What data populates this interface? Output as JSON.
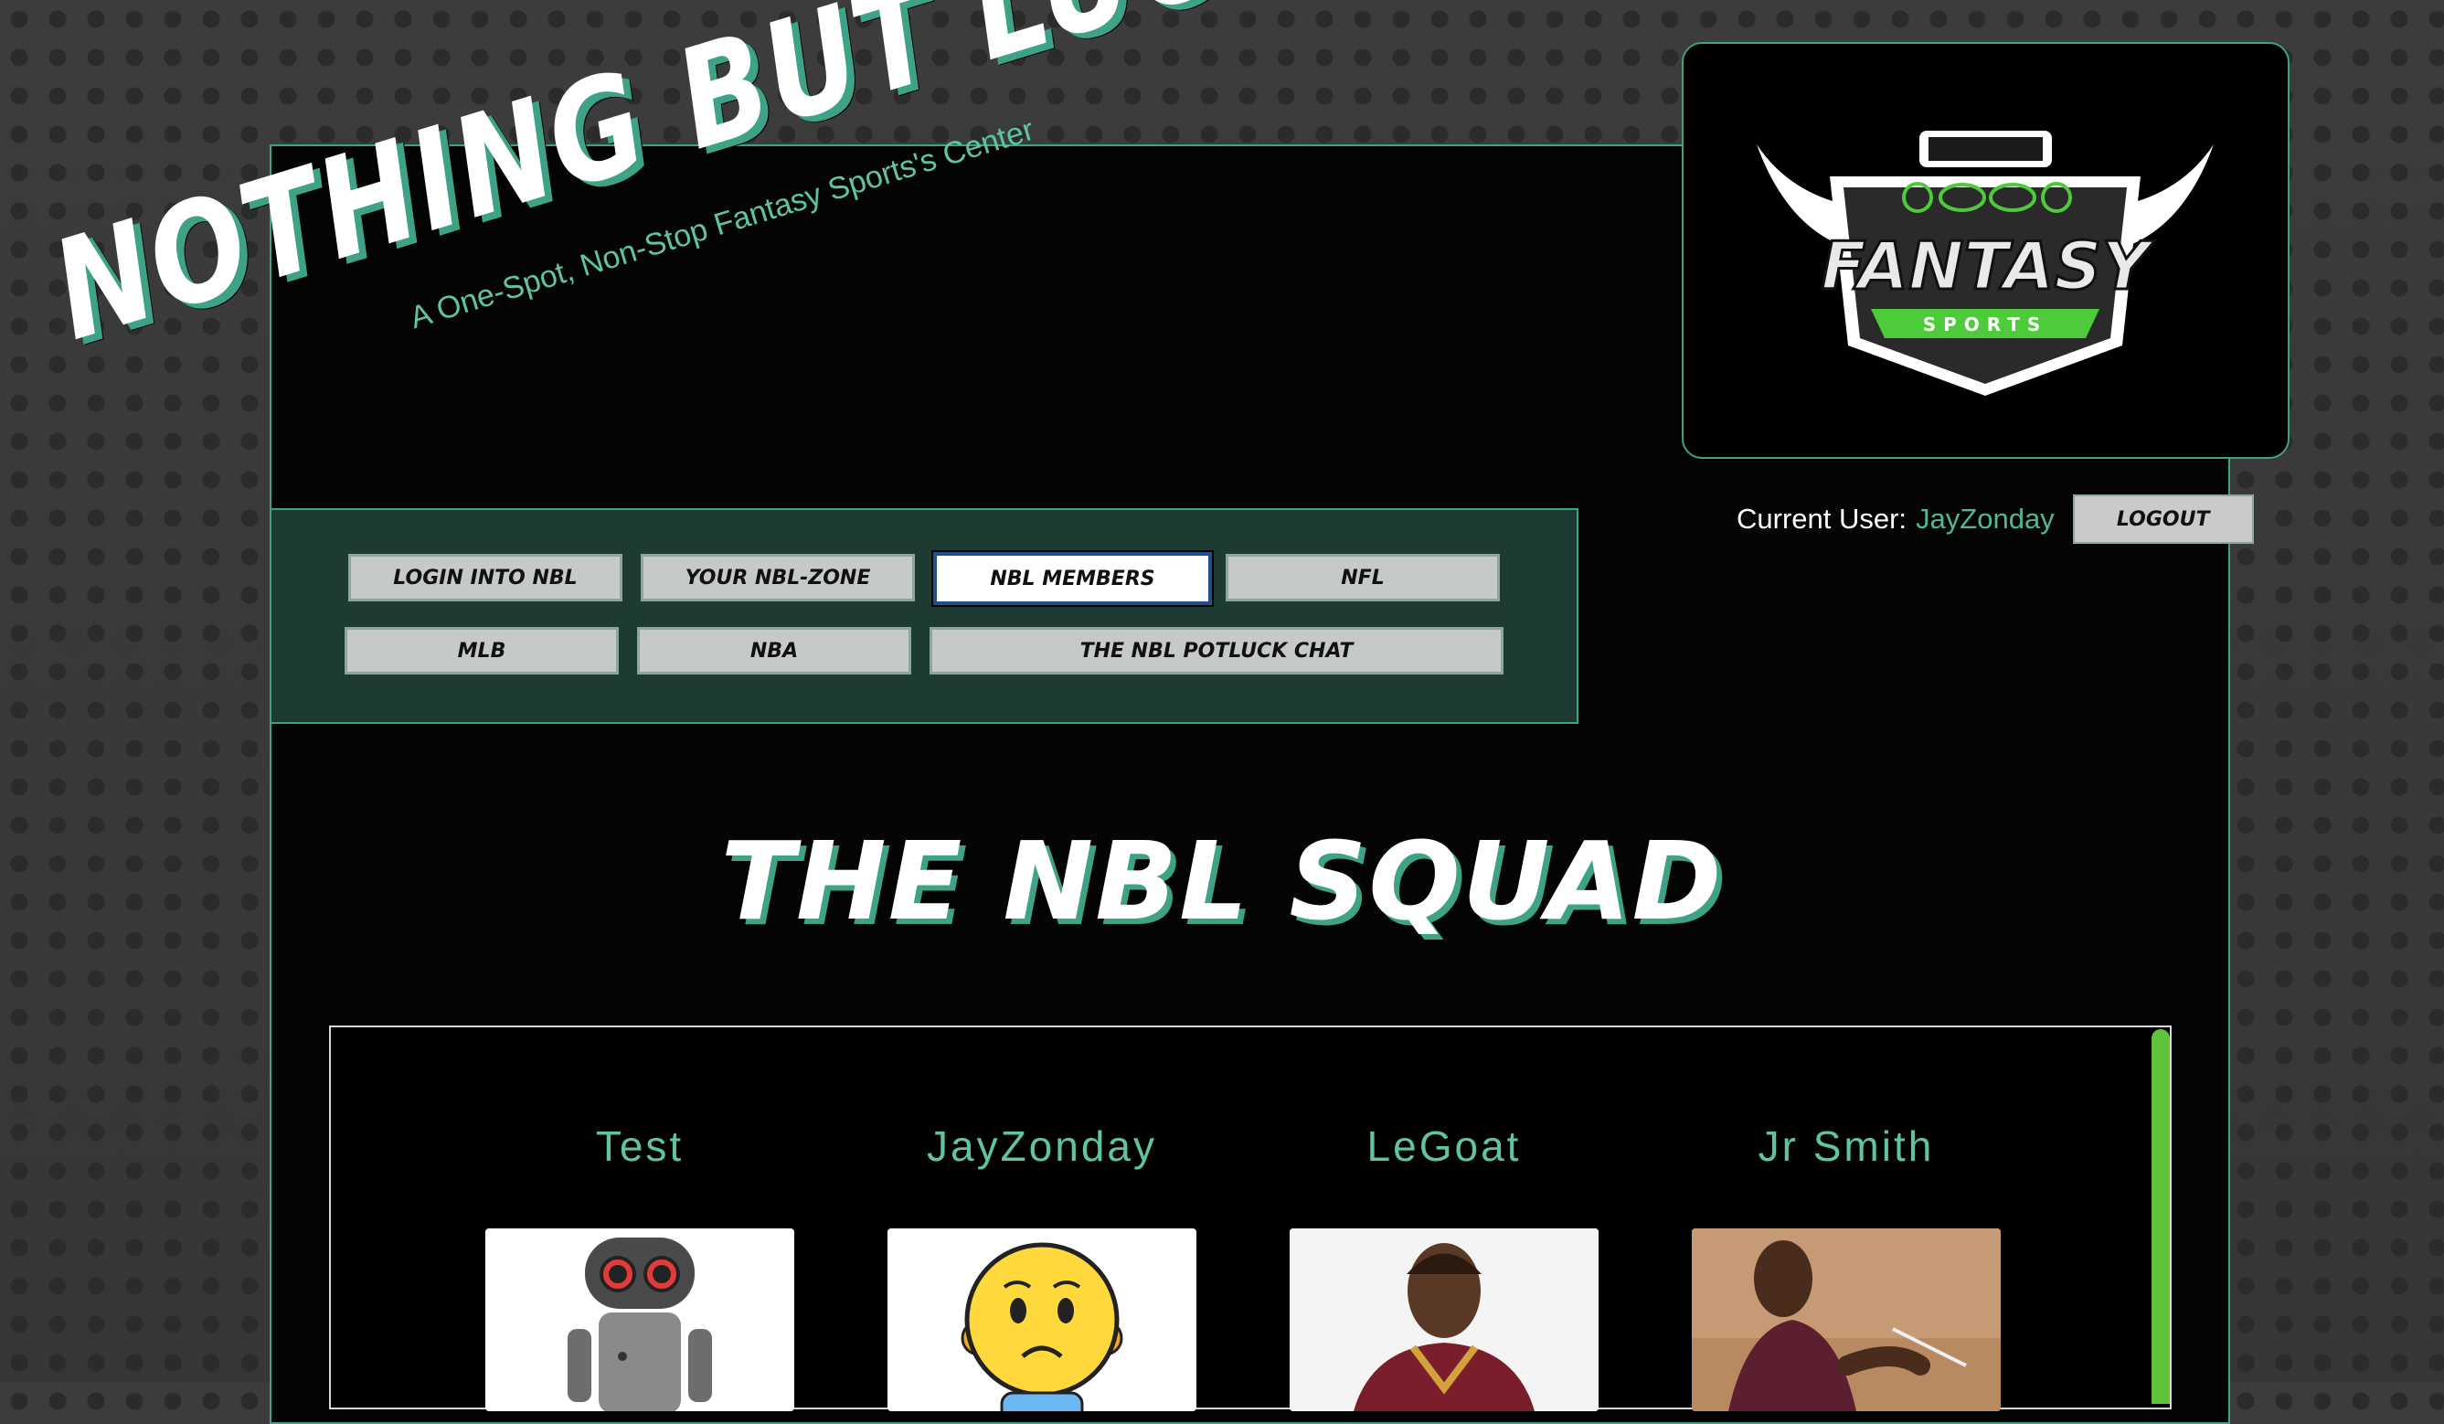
{
  "brand": {
    "title": "Nothing But Luck",
    "subtitle": "A One-Spot, Non-Stop Fantasy Sports's Center"
  },
  "logo": {
    "top_text": "FANTASY",
    "ribbon_text": "SPORTS"
  },
  "user": {
    "label": "Current User:",
    "name": "JayZonday",
    "logout_label": "Logout"
  },
  "nav": {
    "items": [
      {
        "label": "Login into NBL",
        "active": false
      },
      {
        "label": "Your NBL-Zone",
        "active": false
      },
      {
        "label": "NBL Members",
        "active": true
      },
      {
        "label": "NFL",
        "active": false
      },
      {
        "label": "MLB",
        "active": false
      },
      {
        "label": "NBA",
        "active": false
      },
      {
        "label": "The NBL Potluck Chat",
        "active": false
      }
    ]
  },
  "section": {
    "title": "The NBL Squad"
  },
  "members": [
    {
      "name": "Test",
      "avatar": "robot-icon"
    },
    {
      "name": "JayZonday",
      "avatar": "worried-face-icon"
    },
    {
      "name": "LeGoat",
      "avatar": "basketball-player-photo"
    },
    {
      "name": "Jr Smith",
      "avatar": "basketball-player-court-photo"
    }
  ],
  "colors": {
    "accent": "#3ea286",
    "accent_text": "#5fc4a3",
    "nav_bg": "#1e3b33",
    "scroll_thumb": "#5ec33b"
  }
}
